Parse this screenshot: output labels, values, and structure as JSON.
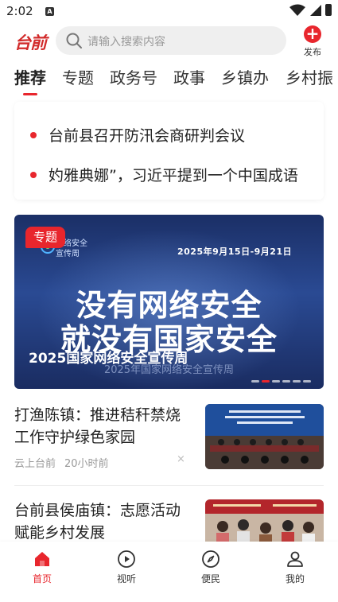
{
  "status_bar": {
    "time": "2:02",
    "notification_letter": "A"
  },
  "header": {
    "logo_text": "台前",
    "search": {
      "placeholder": "请输入搜索内容"
    },
    "publish_label": "发布"
  },
  "tabs": [
    {
      "label": "推荐",
      "active": true
    },
    {
      "label": "专题"
    },
    {
      "label": "政务号"
    },
    {
      "label": "政事"
    },
    {
      "label": "乡镇办"
    },
    {
      "label": "乡村振"
    }
  ],
  "headlines": [
    {
      "text": "台前县召开防汛会商研判会议"
    },
    {
      "text": "妁雅典娜”，习近平提到一个中国成语"
    }
  ],
  "banner": {
    "tag": "专题",
    "logo_text_line1": "网络安全",
    "logo_text_line2": "宣传周",
    "date_range": "2025年9月15日-9月21日",
    "line1": "没有网络安全",
    "line2": "就没有国家安全",
    "caption": "2025国家网络安全宣传周",
    "sub_caption": "2025年国家网络安全宣传周",
    "slide_count": 6,
    "active_slide": 1
  },
  "news": [
    {
      "title": "打渔陈镇：推进秸秆禁烧工作守护绿色家园",
      "source": "云上台前",
      "time": "20小时前",
      "close_icon": "×"
    },
    {
      "title": "台前县侯庙镇：志愿活动赋能乡村发展"
    }
  ],
  "bottom_nav": [
    {
      "label": "首页",
      "icon": "home-icon",
      "active": true
    },
    {
      "label": "视听",
      "icon": "play-circle-icon"
    },
    {
      "label": "便民",
      "icon": "compass-icon"
    },
    {
      "label": "我的",
      "icon": "user-icon"
    }
  ],
  "colors": {
    "accent": "#e8262d",
    "banner_bg": "#1f3673"
  }
}
